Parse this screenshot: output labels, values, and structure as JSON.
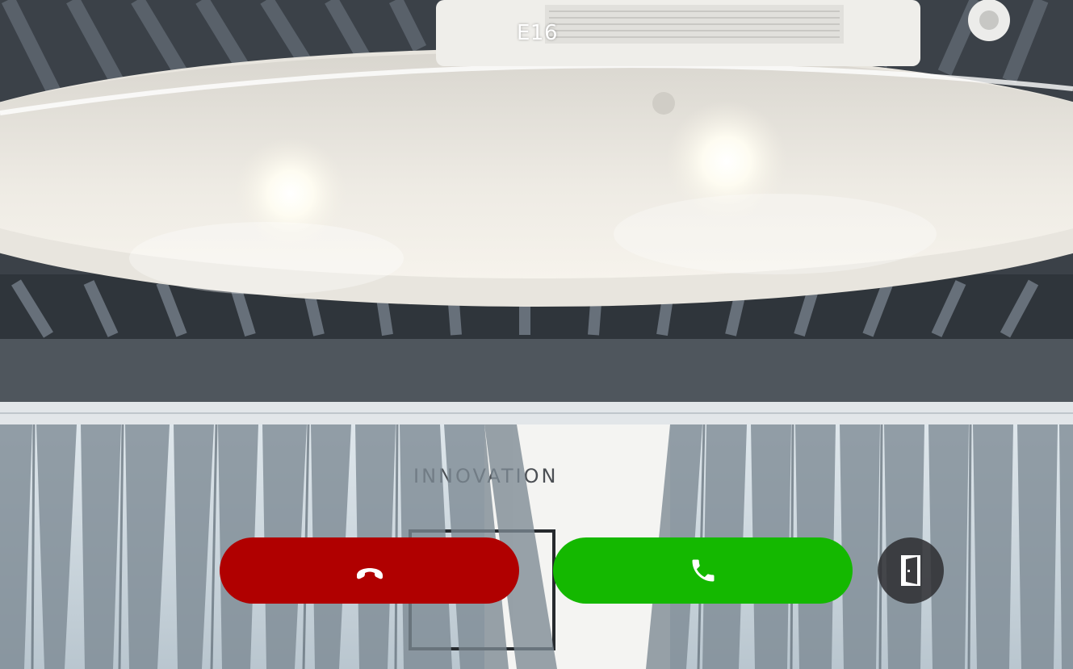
{
  "call": {
    "caller_id": "E16"
  },
  "controls": {
    "decline": {
      "icon": "hang-up-icon",
      "color": "#b00000"
    },
    "answer": {
      "icon": "phone-icon",
      "color": "#14b800"
    },
    "unlock": {
      "icon": "door-icon"
    }
  },
  "background": {
    "wall_sign_text": "INNOVATION"
  }
}
